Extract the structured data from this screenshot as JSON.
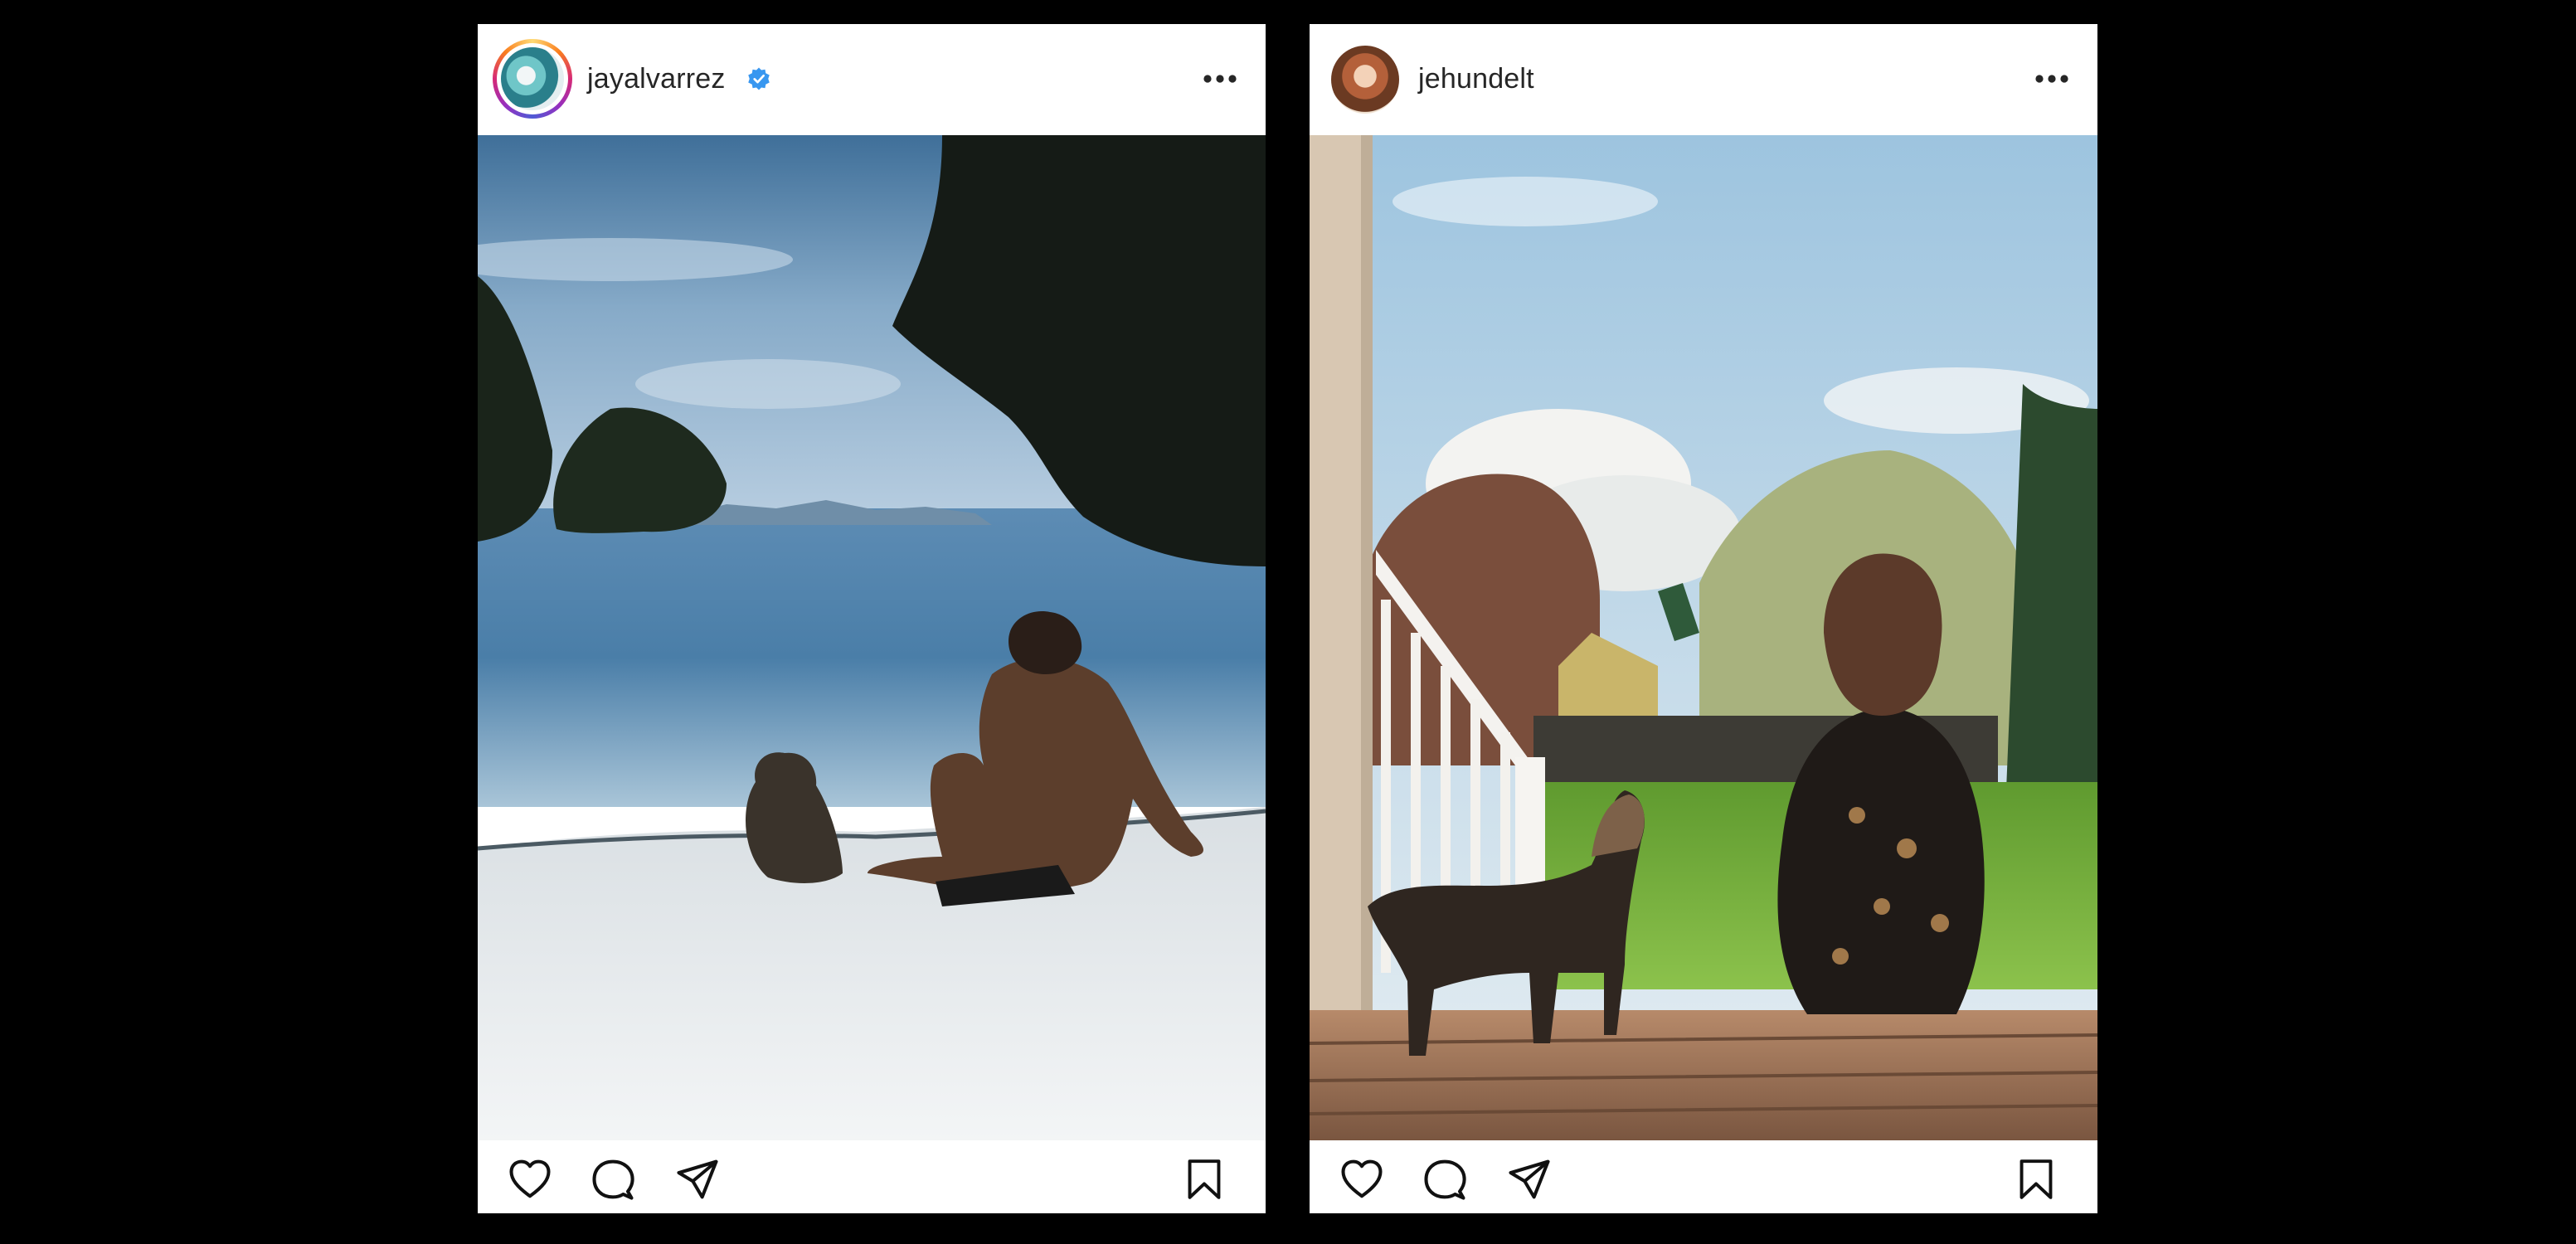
{
  "posts": [
    {
      "username": "jayalvarrez",
      "verified": true,
      "avatar": "beach-avatar",
      "photo": "man-and-monkey-on-tropical-beach",
      "icons": {
        "like": "heart-icon",
        "comment": "comment-icon",
        "share": "paper-plane-icon",
        "save": "bookmark-icon",
        "more": "more-icon"
      }
    },
    {
      "username": "jehundelt",
      "verified": false,
      "avatar": "woman-portrait-avatar",
      "photo": "woman-and-dog-on-porch",
      "icons": {
        "like": "heart-icon",
        "comment": "comment-icon",
        "share": "paper-plane-icon",
        "save": "bookmark-icon",
        "more": "more-icon"
      }
    }
  ],
  "colors": {
    "background": "#000000",
    "card": "#ffffff",
    "text": "#262626",
    "verified": "#3897f0"
  }
}
